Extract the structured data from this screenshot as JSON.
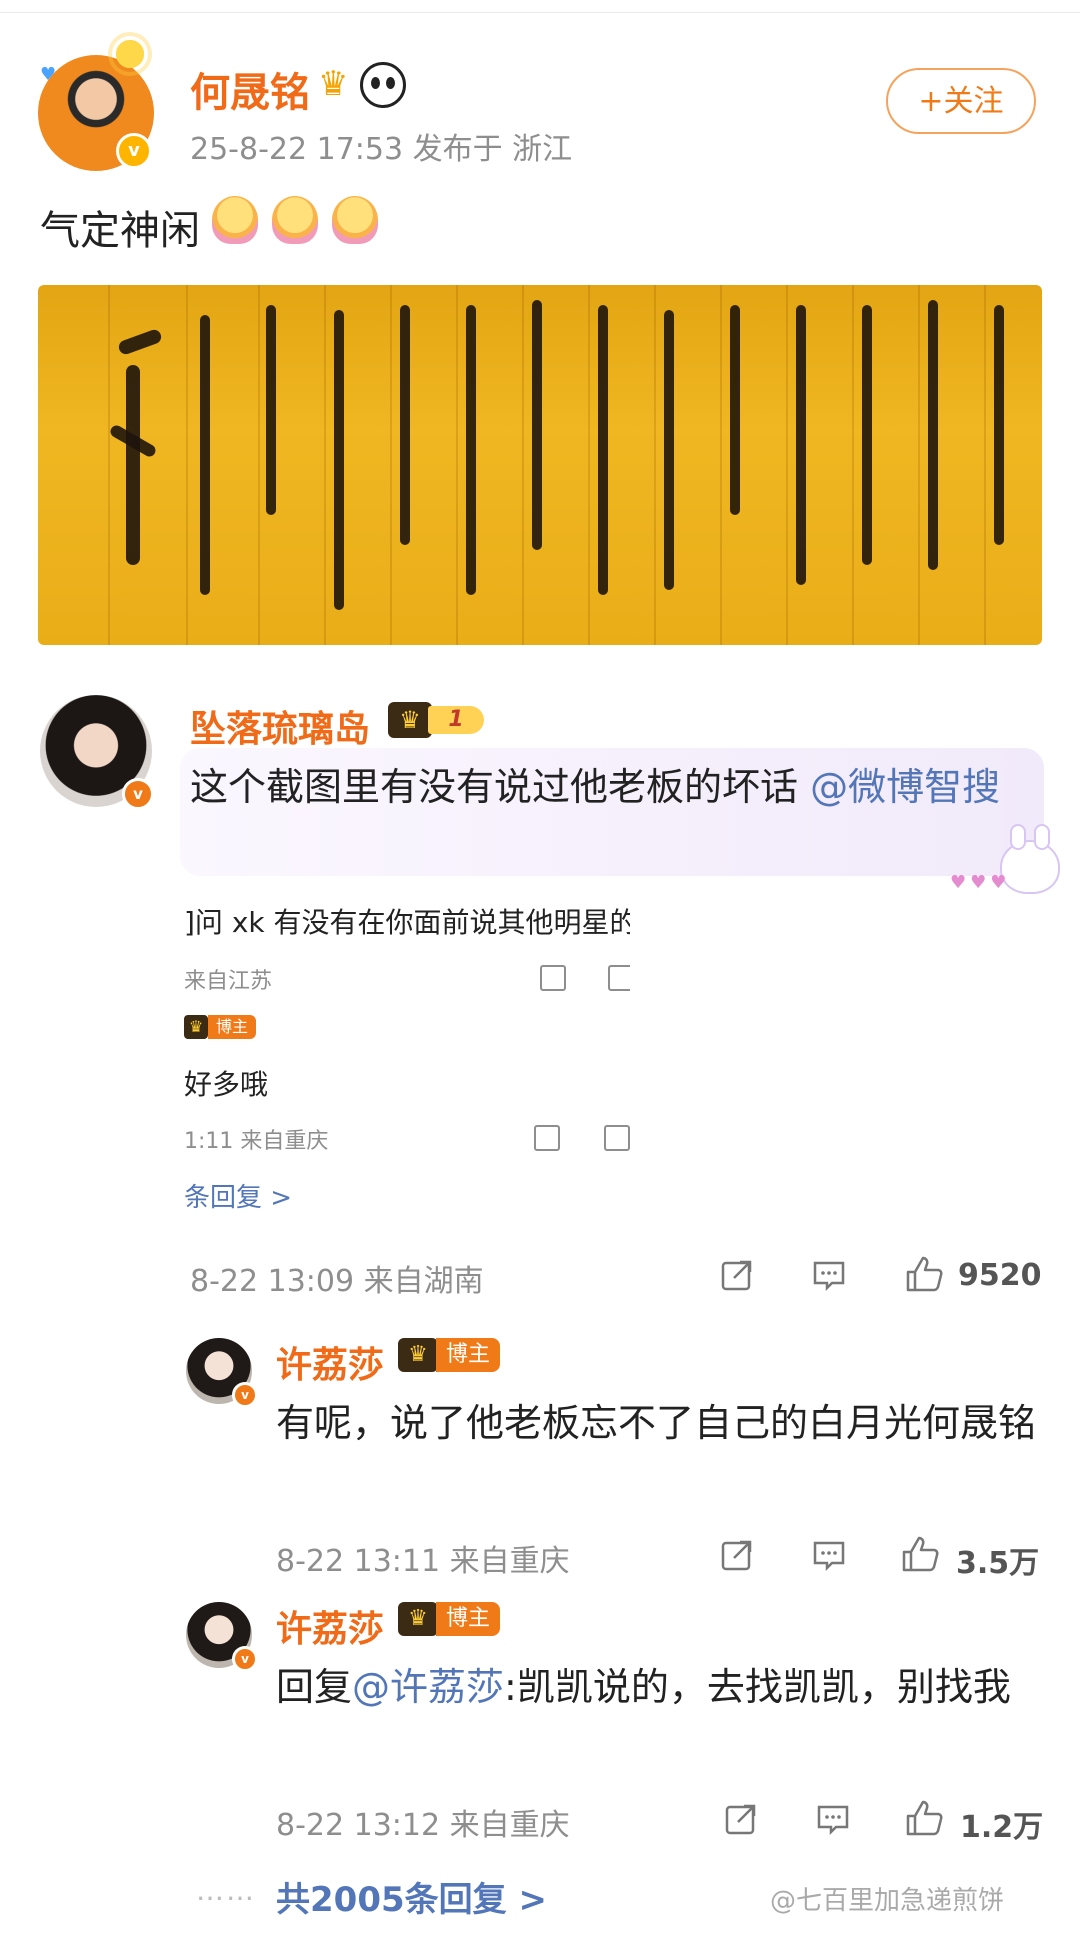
{
  "post": {
    "author": "何晟铭",
    "meta": "25-8-22 17:53  发布于 浙江",
    "follow_label": "+关注",
    "text": "气定神闲"
  },
  "comment": {
    "author": "坠落琉璃岛",
    "level": "1",
    "text_prefix": "这个截图里有没有说过他老板的坏话",
    "mention": "@微博智搜",
    "embedded_screenshot": {
      "line1": "]问 xk 有没有在你面前说其他明星的",
      "line2": "来自江苏",
      "badge": "博主",
      "line4": "好多哦",
      "line5": "1:11  来自重庆",
      "line6": "条回复 >"
    },
    "meta": "8-22 13:09  来自湖南",
    "likes": "9520"
  },
  "replies": [
    {
      "author": "许荔莎",
      "badge": "博主",
      "text": "有呢，说了他老板忘不了自己的白月光何晟铭",
      "meta": "8-22 13:11  来自重庆",
      "likes": "3.5万"
    },
    {
      "author": "许荔莎",
      "badge": "博主",
      "reply_prefix": "回复",
      "mention": "@许荔莎",
      "text": ":凯凯说的，去找凯凯，别找我",
      "meta": "8-22 13:12  来自重庆",
      "likes": "1.2万"
    }
  ],
  "total_replies": "共2005条回复 >",
  "watermark": "@七百里加急递煎饼"
}
